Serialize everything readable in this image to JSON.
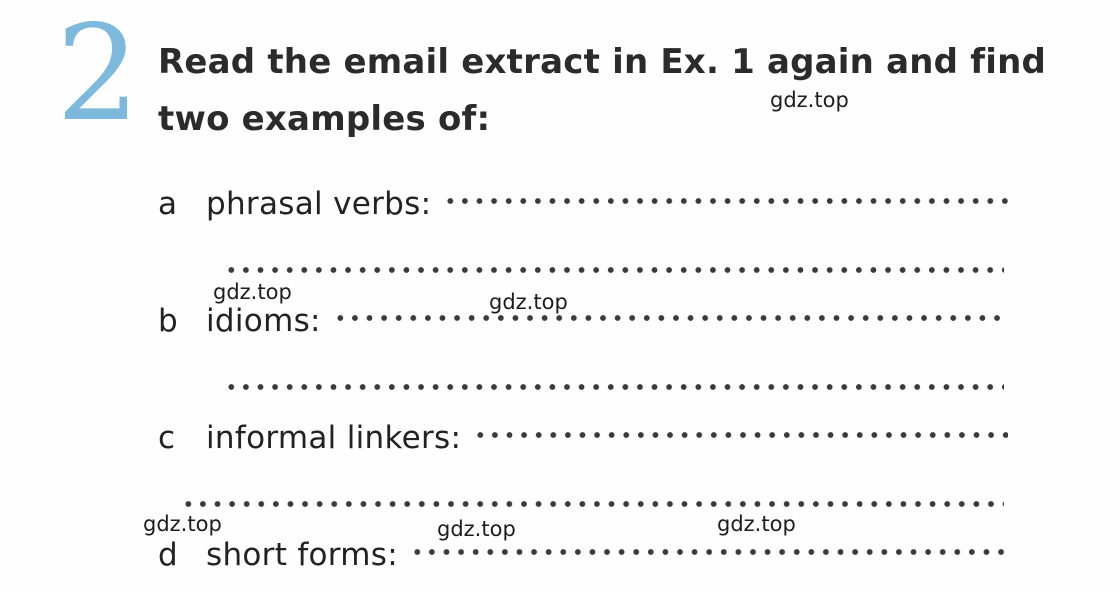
{
  "page": {
    "background_color": "#fefefe",
    "text_color": "#222222"
  },
  "exercise": {
    "number": "2",
    "number_color": "#7cb9dd",
    "heading_line_1": "Read the email extract in Ex. 1 again and find",
    "heading_line_2": "two examples of:"
  },
  "items": [
    {
      "letter": "a",
      "label": "phrasal verbs:"
    },
    {
      "letter": "b",
      "label": "idioms:"
    },
    {
      "letter": "c",
      "label": "informal linkers:"
    },
    {
      "letter": "d",
      "label": "short forms:"
    }
  ],
  "watermarks": [
    {
      "text": "gdz.top"
    },
    {
      "text": "gdz.top"
    },
    {
      "text": "gdz.top"
    },
    {
      "text": "gdz.top"
    },
    {
      "text": "gdz.top"
    },
    {
      "text": "gdz.top"
    }
  ]
}
